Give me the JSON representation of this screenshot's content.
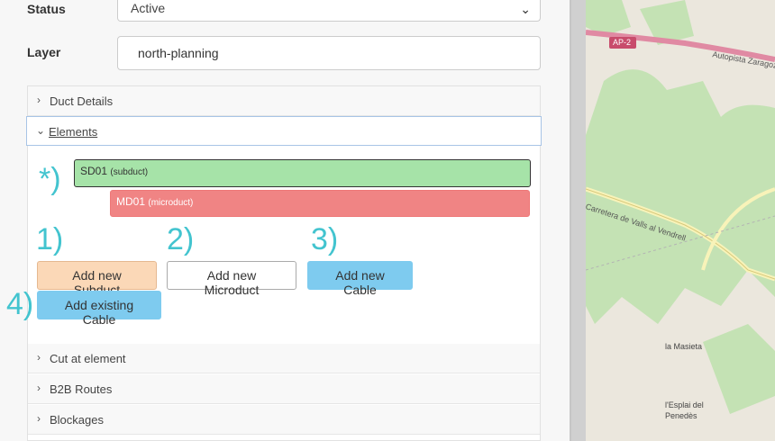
{
  "form": {
    "status_label": "Status",
    "status_value": "Active",
    "layer_label": "Layer",
    "layer_value": "north-planning"
  },
  "accordion": {
    "sections": [
      {
        "label": "Duct Details"
      },
      {
        "label": "Elements"
      },
      {
        "label": "Cut at element"
      },
      {
        "label": "B2B Routes"
      },
      {
        "label": "Blockages"
      }
    ]
  },
  "elements": [
    {
      "name": "SD01",
      "type": "(subduct)"
    },
    {
      "name": "MD01",
      "type": "(microduct)"
    }
  ],
  "buttons": {
    "add_subduct": "Add new Subduct",
    "add_microduct": "Add new Microduct",
    "add_cable": "Add new Cable",
    "add_existing_cable": "Add existing Cable"
  },
  "steps": {
    "star": "*)",
    "one": "1)",
    "two": "2)",
    "three": "3)",
    "four": "4)"
  },
  "map": {
    "road_ap2": "AP-2",
    "road_autopista": "Autopista Zaragoza",
    "road_carretera": "Carretera de Valls al Vendrell",
    "place_masieta": "la Masieta",
    "place_esplai": "l'Esplai del Penedès"
  }
}
